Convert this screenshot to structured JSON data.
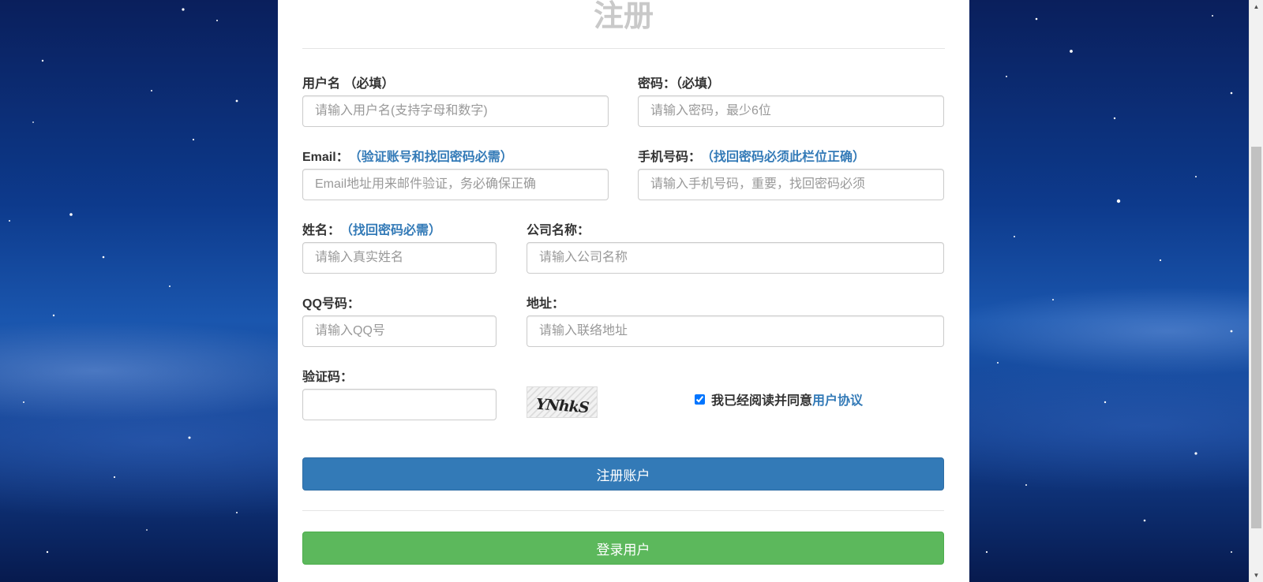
{
  "page": {
    "title": "注册"
  },
  "form": {
    "username": {
      "label": "用户名 （必填）",
      "placeholder": "请输入用户名(支持字母和数字)"
    },
    "password": {
      "label": "密码：（必填）",
      "placeholder": "请输入密码，最少6位"
    },
    "email": {
      "label": "Email：",
      "hint": "（验证账号和找回密码必需）",
      "placeholder": "Email地址用来邮件验证，务必确保正确"
    },
    "phone": {
      "label": "手机号码：",
      "hint": "（找回密码必须此栏位正确）",
      "placeholder": "请输入手机号码，重要，找回密码必须"
    },
    "name": {
      "label": "姓名：",
      "hint": "（找回密码必需）",
      "placeholder": "请输入真实姓名"
    },
    "company": {
      "label": "公司名称：",
      "placeholder": "请输入公司名称"
    },
    "qq": {
      "label": "QQ号码：",
      "placeholder": "请输入QQ号"
    },
    "address": {
      "label": "地址：",
      "placeholder": "请输入联络地址"
    },
    "captcha": {
      "label": "验证码：",
      "value": "",
      "image_text": "YNhkS"
    },
    "agree": {
      "checked": true,
      "text": "我已经阅读并同意",
      "link": "用户协议"
    }
  },
  "buttons": {
    "register": "注册账户",
    "login": "登录用户"
  },
  "colors": {
    "primary": "#337ab7",
    "success": "#5cb85c",
    "hint": "#337ab7"
  }
}
